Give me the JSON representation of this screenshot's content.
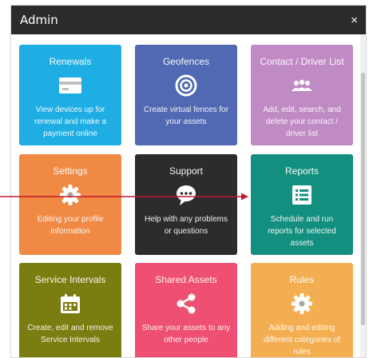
{
  "dialog": {
    "title": "Admin",
    "close_glyph": "×"
  },
  "tiles": [
    {
      "name": "renewals",
      "title": "Renewals",
      "icon": "card-icon",
      "color": "#1eaee4",
      "desc": "View devices up for renewal and make a payment online"
    },
    {
      "name": "geofences",
      "title": "Geofences",
      "icon": "geofence-icon",
      "color": "#5169b2",
      "desc": "Create virtual fences for your assets"
    },
    {
      "name": "contact-driver-list",
      "title": "Contact / Driver List",
      "icon": "people-icon",
      "color": "#c08ac4",
      "desc": "Add, edit, search, and delete your contact / driver list"
    },
    {
      "name": "settings",
      "title": "Settings",
      "icon": "gear-icon",
      "color": "#f08944",
      "desc": "Editing your profile information"
    },
    {
      "name": "support",
      "title": "Support",
      "icon": "chat-icon",
      "color": "#2c2c2e",
      "desc": "Help with any problems or questions"
    },
    {
      "name": "reports",
      "title": "Reports",
      "icon": "list-icon",
      "color": "#138f7f",
      "desc": "Schedule and run reports for selected assets"
    },
    {
      "name": "service-intervals",
      "title": "Service Intervals",
      "icon": "calendar-icon",
      "color": "#7a7d10",
      "desc": "Create, edit and remove Service Intervals"
    },
    {
      "name": "shared-assets",
      "title": "Shared Assets",
      "icon": "share-icon",
      "color": "#ef4f72",
      "desc": "Share your assets to any other people"
    },
    {
      "name": "rules",
      "title": "Rules",
      "icon": "gear-icon",
      "color": "#f4ae52",
      "desc": "Adding and editing different categories of rules"
    }
  ]
}
